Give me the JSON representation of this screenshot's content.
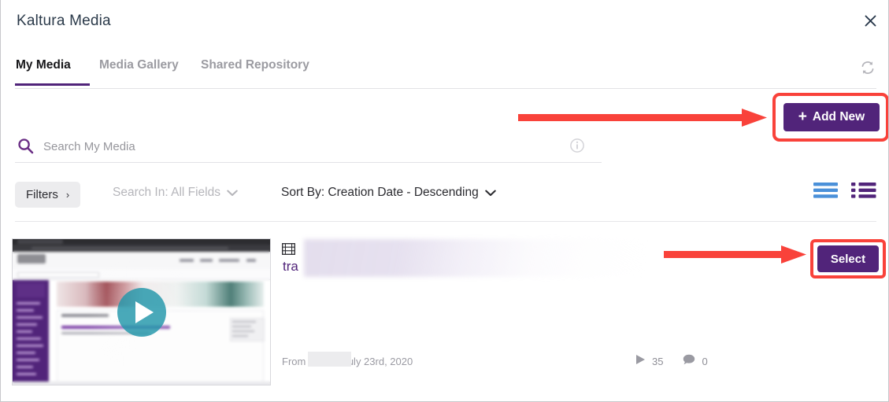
{
  "dialog": {
    "title": "Kaltura Media",
    "close_icon": "close-icon"
  },
  "tabs": [
    {
      "label": "My Media",
      "active": true
    },
    {
      "label": "Media Gallery",
      "active": false
    },
    {
      "label": "Shared Repository",
      "active": false
    }
  ],
  "toolbar_top": {
    "refresh_icon": "refresh-icon",
    "add_new_label": "Add New",
    "add_new_plus": "+"
  },
  "search": {
    "placeholder": "Search My Media",
    "value": "",
    "icon": "search-icon",
    "info_icon": "info-icon"
  },
  "filters": {
    "filters_label": "Filters",
    "filters_chevron": "›",
    "search_in_label": "Search In: All Fields",
    "sort_by_label": "Sort By: Creation Date - Descending"
  },
  "view_toggles": [
    {
      "name": "list-view",
      "active": true,
      "color": "#4a90d9"
    },
    {
      "name": "detail-view",
      "active": false,
      "color": "#51247a"
    }
  ],
  "media_item": {
    "title_visible_text": "tra",
    "title_redacted": true,
    "film_icon": "film-strip-icon",
    "from_label": "From",
    "owner_redacted": true,
    "date": "July 23rd, 2020",
    "plays_count": "35",
    "comments_count": "0",
    "plays_icon": "play-icon",
    "comments_icon": "comment-icon",
    "thumbnail_play_icon": "play-button-icon",
    "select_label": "Select"
  },
  "annotations": {
    "arrow_color": "#f9423a",
    "arrow_add_new": "arrow-pointing-to-add-new",
    "arrow_select": "arrow-pointing-to-select",
    "highlight_color": "#f9423a"
  },
  "colors": {
    "brand_purple": "#51247a",
    "accent_red": "#f9423a",
    "play_teal": "#2196aa",
    "list_blue": "#4a90d9"
  }
}
